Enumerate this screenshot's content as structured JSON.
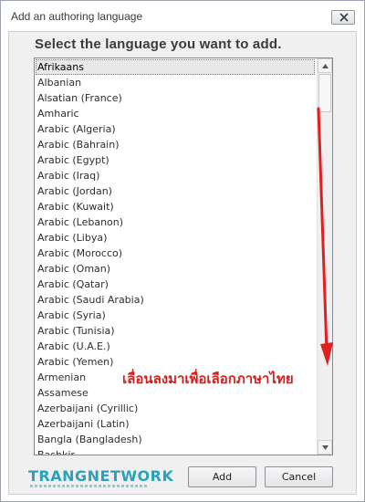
{
  "window": {
    "title": "Add an authoring language",
    "close_icon": "close-icon"
  },
  "prompt": "Select the language you want to add.",
  "languages": [
    "Afrikaans",
    "Albanian",
    "Alsatian (France)",
    "Amharic",
    "Arabic (Algeria)",
    "Arabic (Bahrain)",
    "Arabic (Egypt)",
    "Arabic (Iraq)",
    "Arabic (Jordan)",
    "Arabic (Kuwait)",
    "Arabic (Lebanon)",
    "Arabic (Libya)",
    "Arabic (Morocco)",
    "Arabic (Oman)",
    "Arabic (Qatar)",
    "Arabic (Saudi Arabia)",
    "Arabic (Syria)",
    "Arabic (Tunisia)",
    "Arabic (U.A.E.)",
    "Arabic (Yemen)",
    "Armenian",
    "Assamese",
    "Azerbaijani (Cyrillic)",
    "Azerbaijani (Latin)",
    "Bangla (Bangladesh)",
    "Bashkir"
  ],
  "selected_language": "Afrikaans",
  "annotation": {
    "text": "เลื่อนลงมาเพื่อเลือกภาษาไทย",
    "color": "#d81d1d"
  },
  "watermark": {
    "text": "TRANGNETWORK"
  },
  "buttons": {
    "add": "Add",
    "cancel": "Cancel"
  }
}
